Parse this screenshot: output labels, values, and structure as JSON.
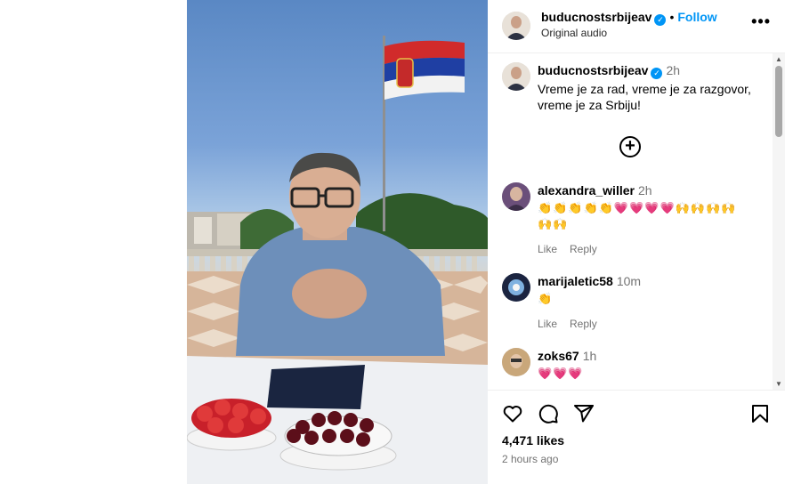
{
  "post": {
    "author": "buducnostsrbijeav",
    "follow_label": "Follow",
    "audio_label": "Original audio",
    "more_label": "•••",
    "caption_time": "2h",
    "caption_text": "Vreme je za rad, vreme je za razgovor, vreme je za Srbiju!",
    "load_more_label": "+"
  },
  "comments": [
    {
      "user": "alexandra_willer",
      "time": "2h",
      "emoji_text": "👏👏👏👏👏💗💗💗💗🙌🙌🙌🙌🙌🙌",
      "like_label": "Like",
      "reply_label": "Reply"
    },
    {
      "user": "marijaletic58",
      "time": "10m",
      "emoji_text": "👏",
      "like_label": "Like",
      "reply_label": "Reply"
    },
    {
      "user": "zoks67",
      "time": "1h",
      "emoji_text": "💗💗💗"
    }
  ],
  "footer": {
    "likes": "4,471 likes",
    "posted": "2 hours ago",
    "icons": [
      "heart-icon",
      "comment-icon",
      "share-icon",
      "bookmark-icon"
    ]
  },
  "colors": {
    "accent": "#0095f6",
    "muted": "#737373"
  }
}
